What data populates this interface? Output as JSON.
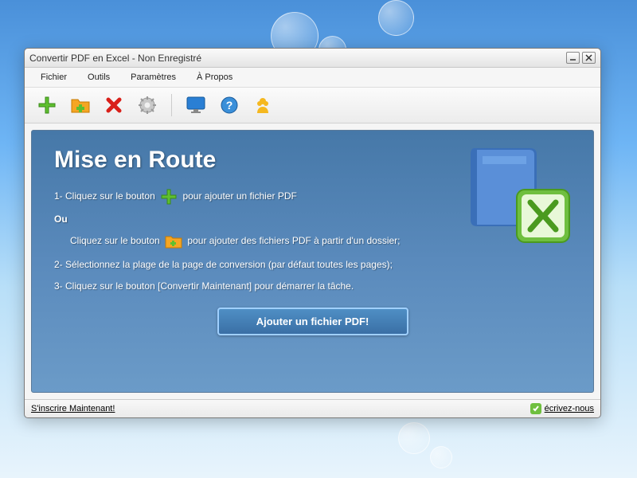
{
  "window": {
    "title": "Convertir PDF en Excel - Non Enregistré"
  },
  "menu": {
    "items": [
      "Fichier",
      "Outils",
      "Paramètres",
      "À Propos"
    ]
  },
  "toolbar": {
    "icons": [
      "plus-icon",
      "folder-icon",
      "delete-icon",
      "gear-icon",
      "monitor-icon",
      "help-icon",
      "user-icon"
    ]
  },
  "panel": {
    "title": "Mise en Route",
    "step1a": "1- Cliquez sur le bouton",
    "step1b": "pour ajouter un fichier PDF",
    "or": "Ou",
    "step1c": "Cliquez sur le bouton",
    "step1d": "pour ajouter des fichiers PDF à partir d'un dossier;",
    "step2": "2- Sélectionnez la plage de la page de conversion (par défaut toutes les pages);",
    "step3": "3- Cliquez sur le bouton [Convertir Maintenant] pour démarrer la tâche.",
    "add_button": "Ajouter un fichier PDF!"
  },
  "status": {
    "register": "S'inscrire Maintenant!",
    "contact": "écrivez-nous"
  }
}
